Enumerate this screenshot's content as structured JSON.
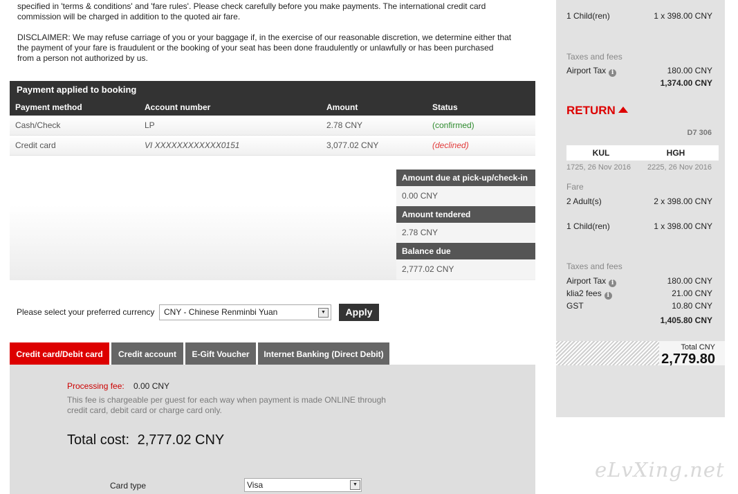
{
  "notice": {
    "line1": "specified in 'terms & conditions' and 'fare rules'. Please check carefully before you make payments. The international credit card",
    "line2": "commission will be charged in addition to the quoted air fare.",
    "disclaimer1": "DISCLAIMER: We may refuse carriage of you or your baggage if, in the exercise of our reasonable discretion, we determine either that",
    "disclaimer2": "the payment of your fare is fraudulent or the booking of your seat has been done fraudulently or unlawfully or has been purchased",
    "disclaimer3": "from a person not authorized by us."
  },
  "payments": {
    "title": "Payment applied to booking",
    "headers": [
      "Payment method",
      "Account number",
      "Amount",
      "Status"
    ],
    "rows": [
      {
        "method": "Cash/Check",
        "account": "LP",
        "amount": "2.78 CNY",
        "status": "(confirmed)"
      },
      {
        "method": "Credit card",
        "account": "VI  XXXXXXXXXXXX0151",
        "amount": "3,077.02 CNY",
        "status": "(declined)"
      }
    ]
  },
  "due": {
    "pickup_label": "Amount due at pick-up/check-in",
    "pickup_value": "0.00 CNY",
    "tendered_label": "Amount tendered",
    "tendered_value": "2.78 CNY",
    "balance_label": "Balance due",
    "balance_value": "2,777.02 CNY"
  },
  "currency": {
    "label": "Please select your preferred currency",
    "selected": "CNY - Chinese Renminbi Yuan",
    "apply_label": "Apply"
  },
  "tabs": [
    {
      "label": "Credit card/Debit card",
      "active": true
    },
    {
      "label": "Credit account",
      "active": false
    },
    {
      "label": "E-Gift Voucher",
      "active": false
    },
    {
      "label": "Internet Banking (Direct Debit)",
      "active": false
    }
  ],
  "card_panel": {
    "fee_label": "Processing fee:",
    "fee_value": "0.00 CNY",
    "fee_note": "This fee is chargeable per guest for each way when payment is made ONLINE through credit card, debit card or charge card only.",
    "total_label": "Total cost:",
    "total_value": "2,777.02 CNY",
    "card_type_label": "Card type",
    "card_type_value": "Visa"
  },
  "sidebar": {
    "depart": {
      "child_label": "1 Child(ren)",
      "child_value": "1 x 398.00 CNY",
      "taxes_label": "Taxes and fees",
      "airport_tax_label": "Airport Tax",
      "airport_tax_value": "180.00 CNY",
      "subtotal": "1,374.00 CNY"
    },
    "return": {
      "title": "RETURN",
      "flight_no": "D7 306",
      "from": "KUL",
      "to": "HGH",
      "depart_time": "1725, 26 Nov 2016",
      "arrive_time": "2225, 26 Nov 2016",
      "fare_label": "Fare",
      "adult_label": "2 Adult(s)",
      "adult_value": "2 x 398.00 CNY",
      "child_label": "1 Child(ren)",
      "child_value": "1 x 398.00 CNY",
      "taxes_label": "Taxes and fees",
      "airport_tax_label": "Airport Tax",
      "airport_tax_value": "180.00 CNY",
      "klia2_label": "klia2 fees",
      "klia2_value": "21.00 CNY",
      "gst_label": "GST",
      "gst_value": "10.80 CNY",
      "subtotal": "1,405.80 CNY"
    },
    "total_label": "Total  CNY",
    "total_value": "2,779.80"
  },
  "watermark": "eLvXing.net",
  "colors": {
    "accent": "#dd0000",
    "dark_header": "#333333",
    "tab_inactive": "#666666",
    "confirmed": "#2e8b2e",
    "declined": "#e23b3b"
  }
}
